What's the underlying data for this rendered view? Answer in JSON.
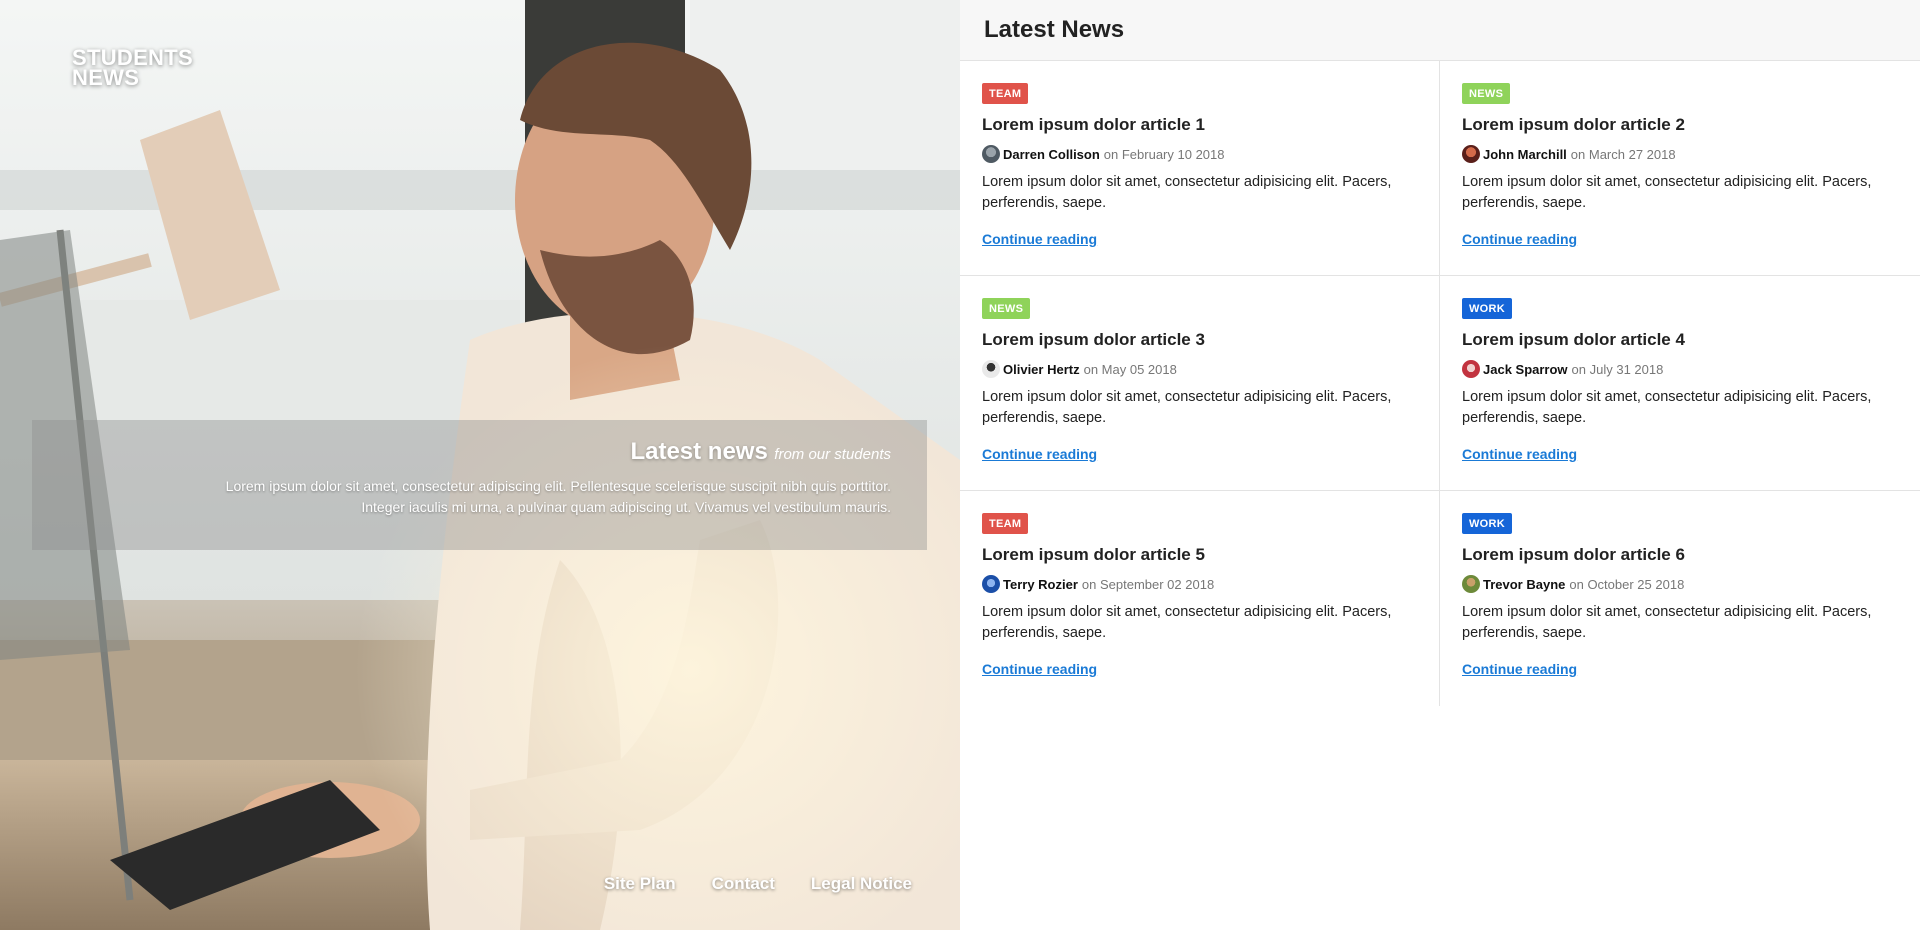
{
  "brand": {
    "line1": "STUDENTS",
    "line2": "NEWS"
  },
  "banner": {
    "title": "Latest news",
    "subtitle": "from our students",
    "text_line1": "Lorem ipsum dolor sit amet, consectetur adipiscing elit. Pellentesque scelerisque suscipit nibh quis porttitor.",
    "text_line2": "Integer iaculis mi urna, a pulvinar quam adipiscing ut. Vivamus vel vestibulum mauris."
  },
  "footer_nav": [
    {
      "label": "Site Plan"
    },
    {
      "label": "Contact"
    },
    {
      "label": "Legal Notice"
    }
  ],
  "panel": {
    "title": "Latest News"
  },
  "colors": {
    "team": "#e0534a",
    "news": "#8fd35a",
    "work": "#1565d8",
    "link": "#1a7ad6"
  },
  "articles": [
    {
      "tag": "TEAM",
      "title": "Lorem ipsum dolor article 1",
      "author": "Darren Collison",
      "date": "on February 10 2018",
      "excerpt": "Lorem ipsum dolor sit amet, consectetur adipisicing elit. Pacers, perferendis, saepe.",
      "link": "Continue reading"
    },
    {
      "tag": "NEWS",
      "title": "Lorem ipsum dolor article 2",
      "author": "John Marchill",
      "date": "on March 27 2018",
      "excerpt": "Lorem ipsum dolor sit amet, consectetur adipisicing elit. Pacers, perferendis, saepe.",
      "link": "Continue reading"
    },
    {
      "tag": "NEWS",
      "title": "Lorem ipsum dolor article 3",
      "author": "Olivier Hertz",
      "date": "on May 05 2018",
      "excerpt": "Lorem ipsum dolor sit amet, consectetur adipisicing elit. Pacers, perferendis, saepe.",
      "link": "Continue reading"
    },
    {
      "tag": "WORK",
      "title": "Lorem ipsum dolor article 4",
      "author": "Jack Sparrow",
      "date": "on July 31 2018",
      "excerpt": "Lorem ipsum dolor sit amet, consectetur adipisicing elit. Pacers, perferendis, saepe.",
      "link": "Continue reading"
    },
    {
      "tag": "TEAM",
      "title": "Lorem ipsum dolor article 5",
      "author": "Terry Rozier",
      "date": "on September 02 2018",
      "excerpt": "Lorem ipsum dolor sit amet, consectetur adipisicing elit. Pacers, perferendis, saepe.",
      "link": "Continue reading"
    },
    {
      "tag": "WORK",
      "title": "Lorem ipsum dolor article 6",
      "author": "Trevor Bayne",
      "date": "on October 25 2018",
      "excerpt": "Lorem ipsum dolor sit amet, consectetur adipisicing elit. Pacers, perferendis, saepe.",
      "link": "Continue reading"
    }
  ]
}
